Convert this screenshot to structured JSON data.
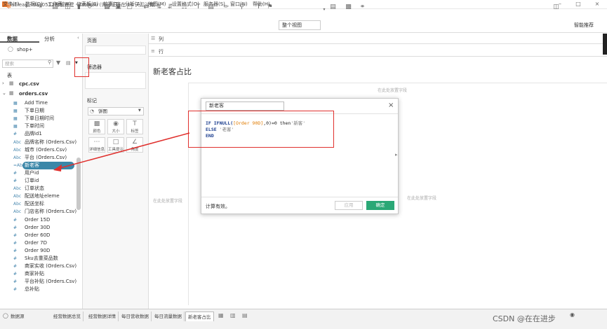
{
  "window": {
    "title": "Tableau - day0512看板搭建 - Tableau (许可证将在 14 天后过期",
    "menu": [
      "文件(F)",
      "数据(D)",
      "工作表(W)",
      "仪表板(B)",
      "故事(T)",
      "分析(A)",
      "地图(M)",
      "设置格式(O)",
      "服务器(S)",
      "窗口(N)",
      "帮助(H)"
    ]
  },
  "toolbar": {
    "view_select": "整个视图",
    "smart_recommend": "智能推荐"
  },
  "data_pane": {
    "tab_data": "数据",
    "tab_analysis": "分析",
    "source": "shop+",
    "search_placeholder": "搜索",
    "tables_label": "表",
    "tables": [
      {
        "name": "cpc.csv"
      },
      {
        "name": "orders.csv"
      }
    ],
    "fields": [
      {
        "icon": "date",
        "name": "Add Time"
      },
      {
        "icon": "date",
        "name": "下单日期"
      },
      {
        "icon": "date",
        "name": "下单日期时间"
      },
      {
        "icon": "date",
        "name": "下单时间"
      },
      {
        "icon": "num",
        "name": "品牌id1"
      },
      {
        "icon": "abc",
        "name": "品牌名称 (Orders.Csv)"
      },
      {
        "icon": "abc",
        "name": "城市 (Orders.Csv)"
      },
      {
        "icon": "abc",
        "name": "平台 (Orders.Csv)"
      },
      {
        "icon": "calc",
        "name": "新老客"
      },
      {
        "icon": "num",
        "name": "用户id"
      },
      {
        "icon": "num",
        "name": "订单id"
      },
      {
        "icon": "abc",
        "name": "订单状态"
      },
      {
        "icon": "abc",
        "name": "配送地址eleme"
      },
      {
        "icon": "abc",
        "name": "配送坐标"
      },
      {
        "icon": "abc",
        "name": "门店名称 (Orders.Csv)"
      },
      {
        "icon": "num",
        "name": "Order 15D"
      },
      {
        "icon": "num",
        "name": "Order 30D"
      },
      {
        "icon": "num",
        "name": "Order 60D"
      },
      {
        "icon": "num",
        "name": "Order 7D"
      },
      {
        "icon": "num",
        "name": "Order 90D"
      },
      {
        "icon": "num",
        "name": "Sku去重菜品数"
      },
      {
        "icon": "num",
        "name": "商家实收 (Orders.Csv)"
      },
      {
        "icon": "num",
        "name": "商家补贴"
      },
      {
        "icon": "num",
        "name": "平台补贴 (Orders.Csv)"
      },
      {
        "icon": "num",
        "name": "总补贴"
      }
    ]
  },
  "cards": {
    "pages": "页面",
    "filters": "筛选器",
    "marks": "标记",
    "mark_type": "饼图",
    "mark_buttons": [
      "颜色",
      "大小",
      "标签",
      "详细信息",
      "工具提示",
      "角度"
    ]
  },
  "shelves": {
    "columns": "列",
    "rows": "行"
  },
  "sheet": {
    "title": "新老客占比",
    "drop_hint": "在此处放置字段"
  },
  "calc_dialog": {
    "name": "新老客",
    "code_line1_kw": "IF",
    "code_line1_fn": "IFNULL(",
    "code_line1_field": "[Order 90D]",
    "code_line1_rest": ",0)=0 then",
    "code_line1_str": "'新客'",
    "code_line2_kw": "ELSE",
    "code_line2_str": "'老客'",
    "code_line3_kw": "END",
    "status": "计算有效。",
    "apply": "应用",
    "ok": "确定"
  },
  "bottom_tabs": {
    "datasource": "数据源",
    "sheets": [
      "经营数据总览",
      "经营数据详情",
      "每日营收数据",
      "每日流量数据",
      "新老客占比"
    ],
    "active_index": 4
  },
  "watermark": "CSDN @在在进步",
  "colors": {
    "accent_green": "#2aa876",
    "selected_field": "#3a87a8",
    "annotation_red": "#e0302d"
  }
}
